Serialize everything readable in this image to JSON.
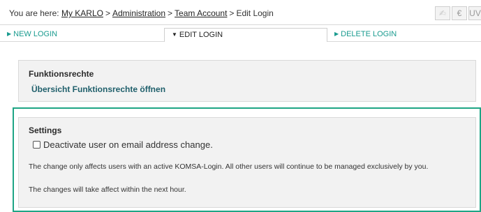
{
  "breadcrumb": {
    "prefix": "You are here:",
    "items": [
      "My KARLO",
      "Administration",
      "Team Account",
      "Edit Login"
    ],
    "separator": ">"
  },
  "toolbar": {
    "buttons": [
      {
        "icon": "sign-icon",
        "glyph": "✍"
      },
      {
        "icon": "euro-icon",
        "glyph": "€"
      },
      {
        "icon": "uv-icon",
        "glyph": "UV"
      }
    ]
  },
  "tabs": [
    {
      "label": "NEW LOGIN",
      "active": false
    },
    {
      "label": "EDIT LOGIN",
      "active": true
    },
    {
      "label": "DELETE LOGIN",
      "active": false
    }
  ],
  "functions_panel": {
    "title": "Funktionsrechte",
    "link": "Übersicht Funktionsrechte öffnen"
  },
  "settings_panel": {
    "title": "Settings",
    "checkbox_label": "Deactivate user on email address change.",
    "checkbox_checked": false,
    "info_1": "The change only affects users with an active KOMSA-Login. All other users will continue to be managed exclusively by you.",
    "info_2": "The changes will take affect within the next hour."
  },
  "colors": {
    "accent": "#1ea585",
    "tab_link": "#1a9b8f",
    "link_dark": "#1f5f6b",
    "panel_bg": "#f2f2f2"
  }
}
